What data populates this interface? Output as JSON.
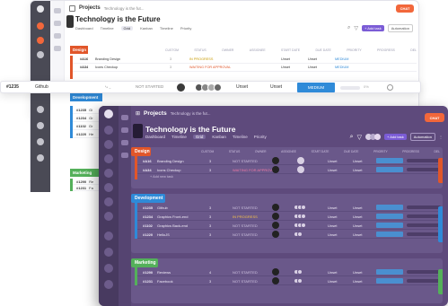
{
  "colors": {
    "design": "#e1562a",
    "development": "#2f8ad8",
    "marketing": "#54b05a",
    "accent": "#7b5cd6",
    "chat": "#f2673b",
    "front_bg": "#5e4a7c"
  },
  "back": {
    "breadcrumb_project": "Projects",
    "breadcrumb_item": "Technology is the fut...",
    "title": "Technology is the Future",
    "tabs": [
      "Dashboard",
      "Timeline",
      "Grid",
      "Kanban",
      "Timeline"
    ],
    "tools": {
      "priority": "Priority",
      "add_task": "+ Add task",
      "automation": "Automation"
    },
    "chat_label": "CHAT",
    "columns": [
      "CUSTOM",
      "STATUS",
      "OWNER",
      "ASSIGNEE",
      "START DATE",
      "DUE DATE",
      "PRIORITY",
      "PROGRESS",
      "DEL"
    ],
    "groups": [
      {
        "name": "Design",
        "rows": [
          {
            "id": "#A16",
            "name": "Branding Design",
            "custom": "3",
            "status": "IN PROGRESS",
            "start": "Unset",
            "due": "Unset",
            "priority": "MEDIUM"
          },
          {
            "id": "#A34",
            "name": "Icons Checkup",
            "custom": "3",
            "status": "WAITING FOR APPROVAL",
            "start": "Unset",
            "due": "Unset",
            "priority": "MEDIUM"
          }
        ]
      },
      {
        "name": "Development",
        "rows": [
          {
            "id": "#1235",
            "name": "Gi"
          },
          {
            "id": "#1234",
            "name": "Gr"
          },
          {
            "id": "#1102",
            "name": "Gr"
          },
          {
            "id": "#1220",
            "name": "He"
          }
        ]
      },
      {
        "name": "Marketing",
        "rows": [
          {
            "id": "#1290",
            "name": "Re"
          },
          {
            "id": "#1231",
            "name": "Fa"
          }
        ]
      }
    ]
  },
  "strip": {
    "id": "#1235",
    "name": "Github",
    "status": "NOT STARTED",
    "start": "Unset",
    "due": "Unset",
    "priority": "MEDIUM",
    "progress": "0%",
    "progress_value": 0
  },
  "front": {
    "breadcrumb_project": "Projects",
    "breadcrumb_item": "Technology is the fut...",
    "title": "Technology is the Future",
    "tabs": [
      "Dashboard",
      "Timeline",
      "Grid",
      "Kanban",
      "Timeline"
    ],
    "tools": {
      "priority": "Priority",
      "add_task": "+ Add task",
      "automation": "Automation"
    },
    "chat_label": "CHAT",
    "columns": [
      "CUSTOM",
      "STATUS",
      "OWNER",
      "ASSIGNEE",
      "START DATE",
      "DUE DATE",
      "PRIORITY",
      "PROGRESS",
      "DEL"
    ],
    "add_label": "+ Add new task",
    "groups": [
      {
        "name": "Design",
        "rows": [
          {
            "id": "#A16",
            "name": "Branding Design",
            "custom": "3",
            "status": "NOT STARTED",
            "start": "Unset",
            "due": "Unset"
          },
          {
            "id": "#A34",
            "name": "Icons Checkup",
            "custom": "3",
            "status": "WAITING FOR APPROVAL",
            "start": "Unset",
            "due": "Unset"
          }
        ]
      },
      {
        "name": "Development",
        "rows": [
          {
            "id": "#1235",
            "name": "Github",
            "custom": "3",
            "status": "NOT STARTED",
            "start": "Unset",
            "due": "Unset"
          },
          {
            "id": "#1234",
            "name": "Graphics Front-end",
            "custom": "3",
            "status": "IN PROGRESS",
            "start": "Unset",
            "due": "Unset"
          },
          {
            "id": "#1102",
            "name": "Graphics Back-end",
            "custom": "3",
            "status": "NOT STARTED",
            "start": "Unset",
            "due": "Unset"
          },
          {
            "id": "#1220",
            "name": "HelloJS",
            "custom": "3",
            "status": "NOT STARTED",
            "start": "Unset",
            "due": "Unset"
          }
        ]
      },
      {
        "name": "Marketing",
        "rows": [
          {
            "id": "#1290",
            "name": "Reviews",
            "custom": "4",
            "status": "NOT STARTED",
            "start": "Unset",
            "due": "Unset"
          },
          {
            "id": "#1231",
            "name": "Facebook",
            "custom": "3",
            "status": "NOT STARTED",
            "start": "Unset",
            "due": "Unset"
          }
        ]
      }
    ]
  }
}
